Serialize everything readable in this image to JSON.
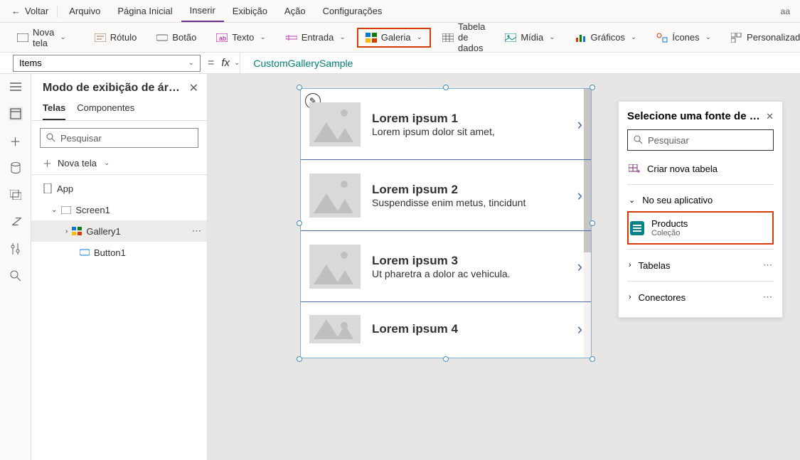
{
  "menubar": {
    "back": "Voltar",
    "items": [
      "Arquivo",
      "Página Inicial",
      "Inserir",
      "Exibição",
      "Ação",
      "Configurações"
    ],
    "active": 2,
    "user": "aa"
  },
  "ribbon": {
    "items": [
      {
        "label": "Nova tela",
        "icon": "screen",
        "drop": true
      },
      {
        "label": "Rótulo",
        "icon": "label",
        "drop": false
      },
      {
        "label": "Botão",
        "icon": "button",
        "drop": false
      },
      {
        "label": "Texto",
        "icon": "text",
        "drop": true
      },
      {
        "label": "Entrada",
        "icon": "input",
        "drop": true
      },
      {
        "label": "Galeria",
        "icon": "gallery",
        "drop": true,
        "highlight": true
      },
      {
        "label": "Tabela de dados",
        "icon": "table",
        "drop": false
      },
      {
        "label": "Mídia",
        "icon": "media",
        "drop": true
      },
      {
        "label": "Gráficos",
        "icon": "chart",
        "drop": true
      },
      {
        "label": "Ícones",
        "icon": "icons",
        "drop": true
      },
      {
        "label": "Personalizado",
        "icon": "custom",
        "drop": true
      }
    ]
  },
  "formula": {
    "property": "Items",
    "value": "CustomGallerySample"
  },
  "tree": {
    "title": "Modo de exibição de ár…",
    "tabs": [
      "Telas",
      "Componentes"
    ],
    "activeTab": 0,
    "search_ph": "Pesquisar",
    "newscreen": "Nova tela",
    "nodes": {
      "app": "App",
      "screen": "Screen1",
      "gallery": "Gallery1",
      "button": "Button1"
    }
  },
  "gallery": {
    "items": [
      {
        "title": "Lorem ipsum 1",
        "sub": "Lorem ipsum dolor sit amet,"
      },
      {
        "title": "Lorem ipsum 2",
        "sub": "Suspendisse enim metus, tincidunt"
      },
      {
        "title": "Lorem ipsum 3",
        "sub": "Ut pharetra a dolor ac vehicula."
      },
      {
        "title": "Lorem ipsum 4",
        "sub": ""
      }
    ]
  },
  "datasource": {
    "title": "Selecione uma fonte de …",
    "search_ph": "Pesquisar",
    "create": "Criar nova tabela",
    "inapp": "No seu aplicativo",
    "product": {
      "name": "Products",
      "type": "Coleção"
    },
    "tables": "Tabelas",
    "connectors": "Conectores"
  }
}
